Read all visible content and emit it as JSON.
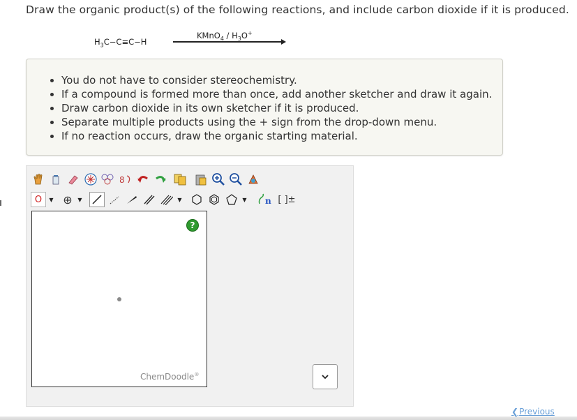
{
  "question": "Draw the organic product(s) of the following reactions, and include carbon dioxide if it is produced.",
  "reaction": {
    "reactant_parts": [
      "H",
      "3",
      "C−C≡C−H"
    ],
    "reagent_parts": [
      "KMnO",
      "4",
      " / H",
      "3",
      "O",
      "+"
    ]
  },
  "instructions": [
    "You do not have to consider stereochemistry.",
    "If a compound is formed more than once, add another sketcher and draw it again.",
    "Draw carbon dioxide in its own sketcher if it is produced.",
    "Separate multiple products using the + sign from the drop-down menu.",
    "If no reaction occurs, draw the organic starting material."
  ],
  "sketcher": {
    "element_label": "O",
    "charge_label": "⊕",
    "help_label": "?",
    "brand": "ChemDoodle",
    "brand_mark": "®",
    "select_arrow": "⌵",
    "sgroup_label": "n",
    "bracket_label": "[ ]±"
  },
  "nav": {
    "previous_label": "Previous"
  },
  "colors": {
    "help_green": "#2f9a2f",
    "element_red": "#d02020",
    "link_blue": "#6aa0d8"
  }
}
